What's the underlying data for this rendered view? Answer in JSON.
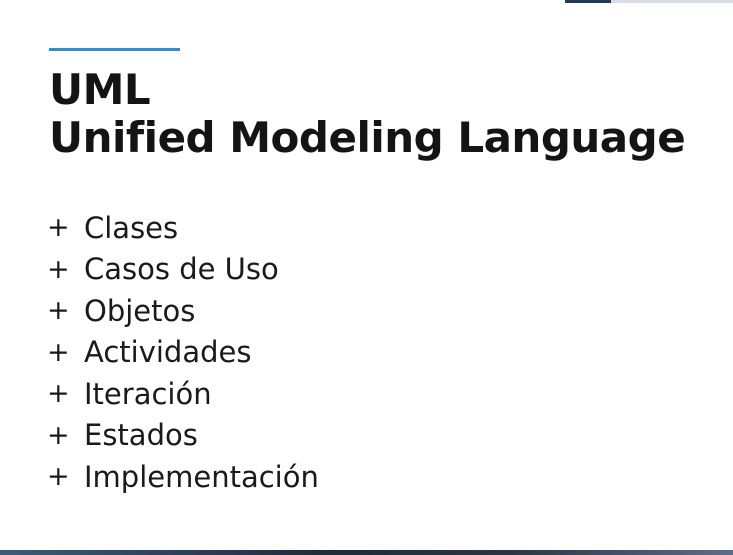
{
  "slide": {
    "title_line1": "UML",
    "title_line2": "Unified Modeling Language",
    "bullet_marker": "+",
    "items": [
      "Clases",
      "Casos de Uso",
      "Objetos",
      "Actividades",
      "Iteración",
      "Estados",
      "Implementación"
    ]
  },
  "colors": {
    "accent": "#2f8fd0",
    "text": "#141414",
    "background": "#ffffff"
  }
}
